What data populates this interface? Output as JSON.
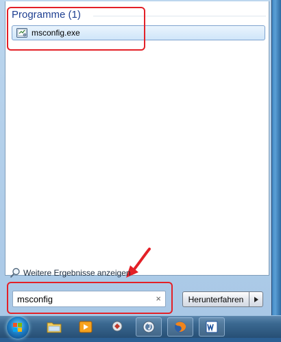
{
  "results": {
    "group_title": "Programme (1)",
    "items": [
      {
        "label": "msconfig.exe",
        "icon": "msconfig-icon"
      }
    ]
  },
  "more_results": {
    "label": "Weitere Ergebnisse anzeigen",
    "icon": "magnifier-icon"
  },
  "search": {
    "value": "msconfig",
    "clear_symbol": "×"
  },
  "shutdown": {
    "label": "Herunterfahren",
    "arrow_icon": "triangle-right-icon"
  },
  "taskbar": {
    "items": [
      {
        "name": "explorer",
        "icon": "folder-icon"
      },
      {
        "name": "media-player",
        "icon": "media-player-icon"
      },
      {
        "name": "app",
        "icon": "app-icon"
      },
      {
        "name": "itunes",
        "icon": "itunes-icon",
        "pinned": true
      },
      {
        "name": "firefox",
        "icon": "firefox-icon",
        "pinned": true
      },
      {
        "name": "word",
        "icon": "word-icon",
        "pinned": true
      }
    ]
  },
  "colors": {
    "annotation": "#e32027",
    "group_title": "#1e3f91",
    "selection": "#cfe5f9"
  }
}
